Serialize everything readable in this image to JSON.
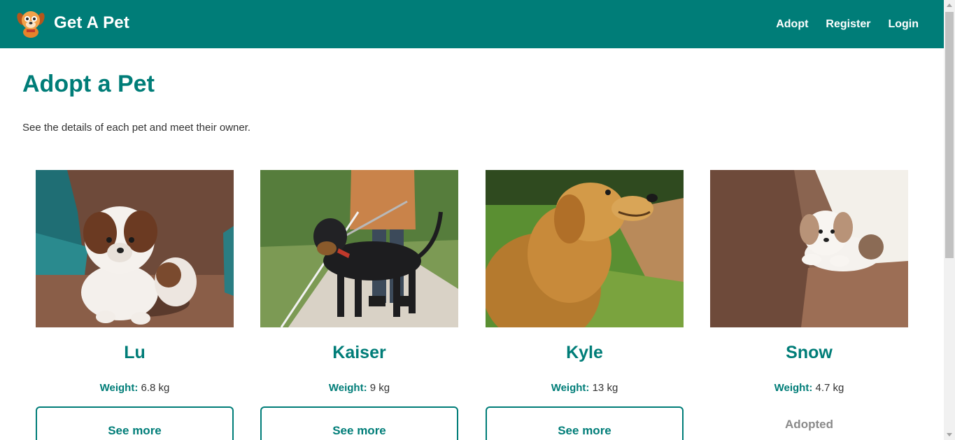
{
  "navbar": {
    "brand": "Get A Pet",
    "links": [
      "Adopt",
      "Register",
      "Login"
    ],
    "bg_color": "#007d78"
  },
  "main": {
    "title": "Adopt a Pet",
    "subtitle": "See the details of each pet and meet their owner."
  },
  "pets": [
    {
      "name": "Lu",
      "weight_label": "Weight:",
      "weight_value": "6.8 kg",
      "action": "See more",
      "status": "available"
    },
    {
      "name": "Kaiser",
      "weight_label": "Weight:",
      "weight_value": "9 kg",
      "action": "See more",
      "status": "available"
    },
    {
      "name": "Kyle",
      "weight_label": "Weight:",
      "weight_value": "13 kg",
      "action": "See more",
      "status": "available"
    },
    {
      "name": "Snow",
      "weight_label": "Weight:",
      "weight_value": "4.7 kg",
      "action": "Adopted",
      "status": "adopted"
    }
  ],
  "icons": {
    "logo": "dog-logo-icon"
  },
  "colors": {
    "accent": "#007d78",
    "muted": "#8a8a8a"
  }
}
